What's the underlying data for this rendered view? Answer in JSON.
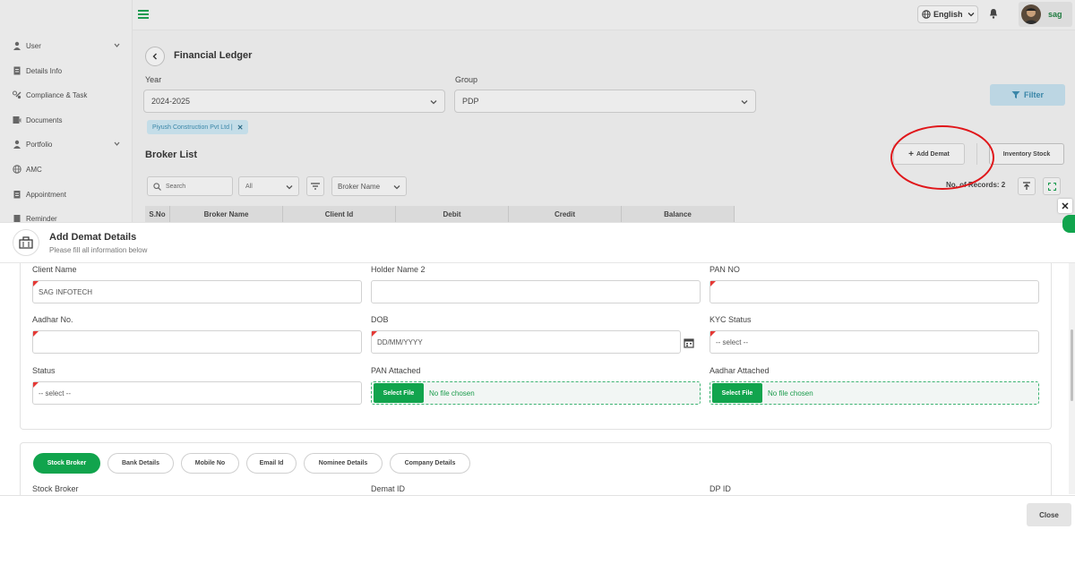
{
  "sidebar": {
    "items": [
      {
        "label": "User",
        "icon": "user-icon",
        "has_chevron": true
      },
      {
        "label": "Details Info",
        "icon": "document-icon",
        "has_chevron": false
      },
      {
        "label": "Compliance & Task",
        "icon": "tasks-icon",
        "has_chevron": false
      },
      {
        "label": "Documents",
        "icon": "folder-icon",
        "has_chevron": false
      },
      {
        "label": "Portfolio",
        "icon": "user-icon",
        "has_chevron": true
      },
      {
        "label": "AMC",
        "icon": "globe-icon",
        "has_chevron": false
      },
      {
        "label": "Appointment",
        "icon": "calendar-icon",
        "has_chevron": false
      },
      {
        "label": "Reminder",
        "icon": "reminder-icon",
        "has_chevron": false
      }
    ]
  },
  "topbar": {
    "language": "English",
    "user_name": "sag"
  },
  "page": {
    "title": "Financial Ledger",
    "year_label": "Year",
    "year_value": "2024-2025",
    "group_label": "Group",
    "group_value": "PDP",
    "filter_label": "Filter",
    "chip_label": "Piyush Construction Pvt Ltd |",
    "broker_title": "Broker List",
    "add_demat_label": "Add Demat",
    "inventory_label": "Inventory Stock",
    "search_placeholder": "Search",
    "all_label": "All",
    "column_select": "Broker Name",
    "records_label": "No. of Records: 2",
    "columns": [
      "S.No",
      "Broker Name",
      "Client Id",
      "Debit",
      "Credit",
      "Balance"
    ]
  },
  "modal": {
    "title": "Add Demat Details",
    "subtitle": "Please fill all information below",
    "fields": {
      "client_name_label": "Client Name",
      "client_name_value": "SAG INFOTECH",
      "holder2_label": "Holder Name 2",
      "pan_label": "PAN NO",
      "aadhar_label": "Aadhar No.",
      "dob_label": "DOB",
      "dob_placeholder": "DD/MM/YYYY",
      "kyc_label": "KYC Status",
      "kyc_value": "-- select --",
      "status_label": "Status",
      "status_value": "-- select --",
      "pan_attached_label": "PAN Attached",
      "aadhar_attached_label": "Aadhar Attached",
      "select_file": "Select File",
      "no_file": "No file chosen"
    },
    "tabs": [
      "Stock Broker",
      "Bank Details",
      "Mobile No",
      "Email Id",
      "Nominee Details",
      "Company Details"
    ],
    "active_tab": "Stock Broker",
    "section_labels": {
      "stock_broker": "Stock Broker",
      "demat_id": "Demat ID",
      "dp_id": "DP ID"
    },
    "close_label": "Close"
  },
  "colors": {
    "accent_green": "#11a44d",
    "filter_blue": "#3a86a8",
    "annotation_red": "#e0161a"
  }
}
